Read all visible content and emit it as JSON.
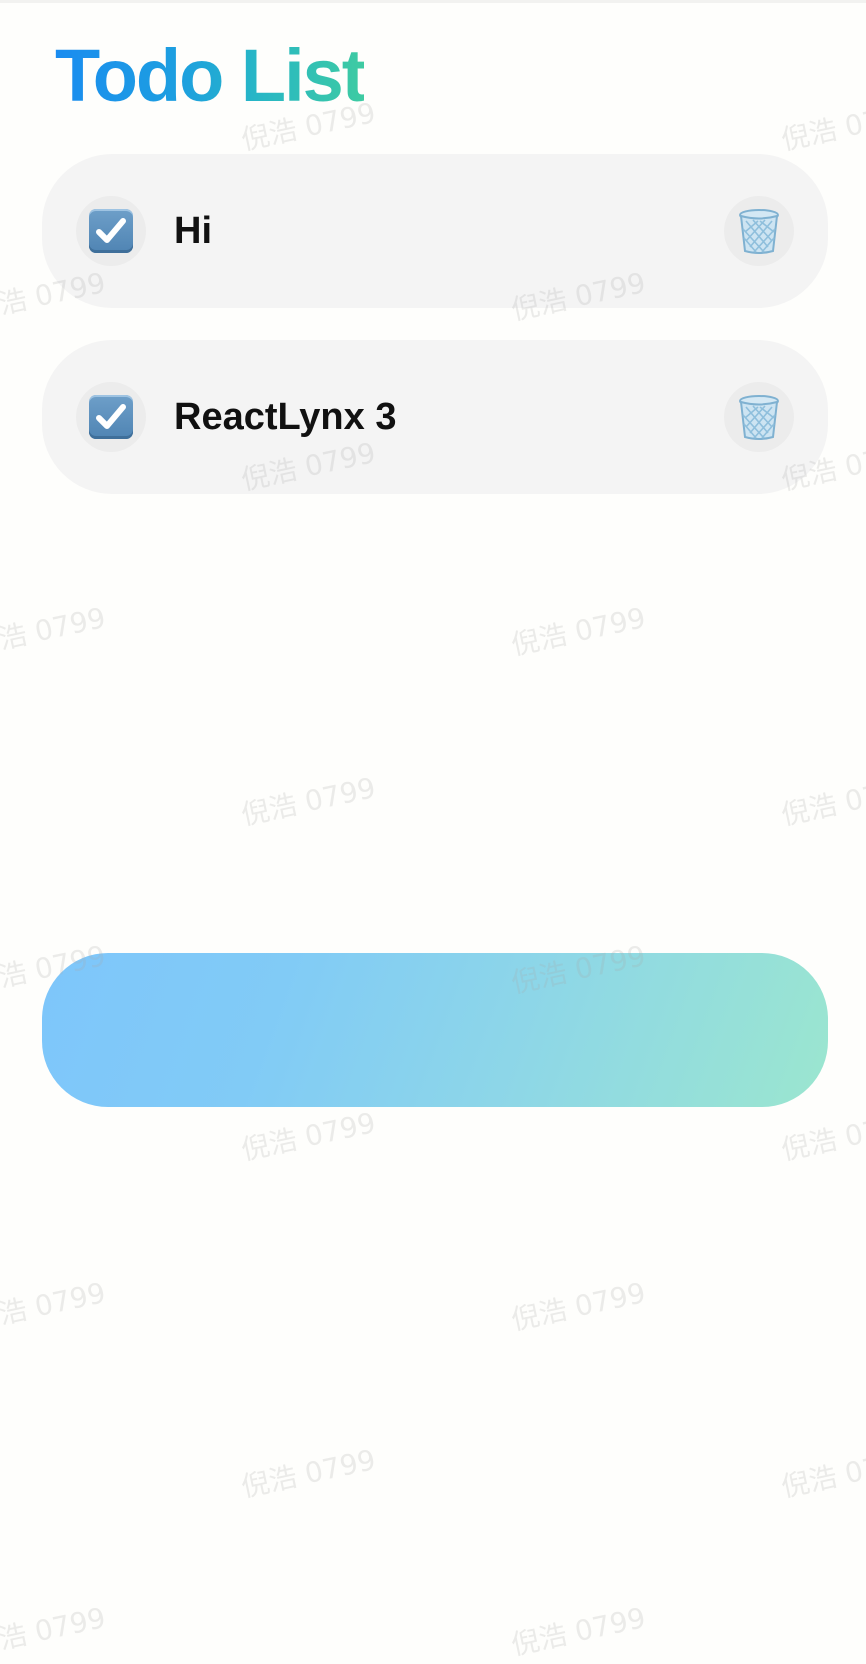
{
  "app": {
    "title": "Todo List",
    "title_gradient": [
      "#1a8cf0",
      "#3ecba2"
    ]
  },
  "todos": [
    {
      "text": "Hi",
      "done": true,
      "check_icon": "checked-box-icon",
      "delete_icon": "wastebasket-icon"
    },
    {
      "text": "ReactLynx 3",
      "done": true,
      "check_icon": "checked-box-icon",
      "delete_icon": "wastebasket-icon"
    }
  ],
  "add_bar": {
    "gradient": [
      "#7ec6fb",
      "#9be6cf"
    ]
  },
  "colors": {
    "background": "#fefefc",
    "item_background": "#f4f4f4",
    "icon_circle": "#ececec",
    "text": "#111111"
  },
  "watermark": {
    "text": "倪浩 0799"
  }
}
